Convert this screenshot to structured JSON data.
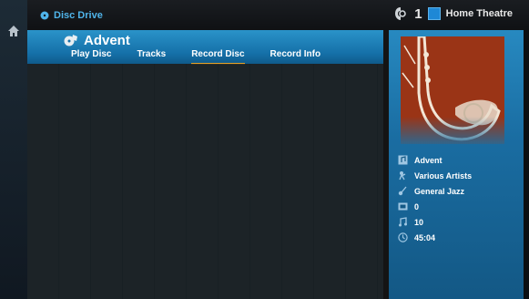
{
  "topbar": {
    "title": "Disc Drive",
    "zone_number": "1",
    "zone_name": "Home Theatre"
  },
  "album": {
    "title": "Advent"
  },
  "tabs": [
    {
      "label": "Play Disc",
      "active": false
    },
    {
      "label": "Tracks",
      "active": false
    },
    {
      "label": "Record Disc",
      "active": true
    },
    {
      "label": "Record Info",
      "active": false
    }
  ],
  "info": {
    "album": "Advent",
    "artist": "Various Artists",
    "genre": "General Jazz",
    "disc_count": "0",
    "track_count": "10",
    "duration": "45:04"
  },
  "colors": {
    "accent": "#4fb4ea",
    "tab_underline": "#e3a12a",
    "panel_blue": "#1e7db5",
    "art": "#9a3416"
  },
  "icons": [
    "home-icon",
    "disc-icon",
    "zone-icon",
    "album-icon",
    "music-note-icon",
    "microphone-icon",
    "guitar-icon",
    "disc-count-icon",
    "tracks-icon",
    "clock-icon"
  ]
}
